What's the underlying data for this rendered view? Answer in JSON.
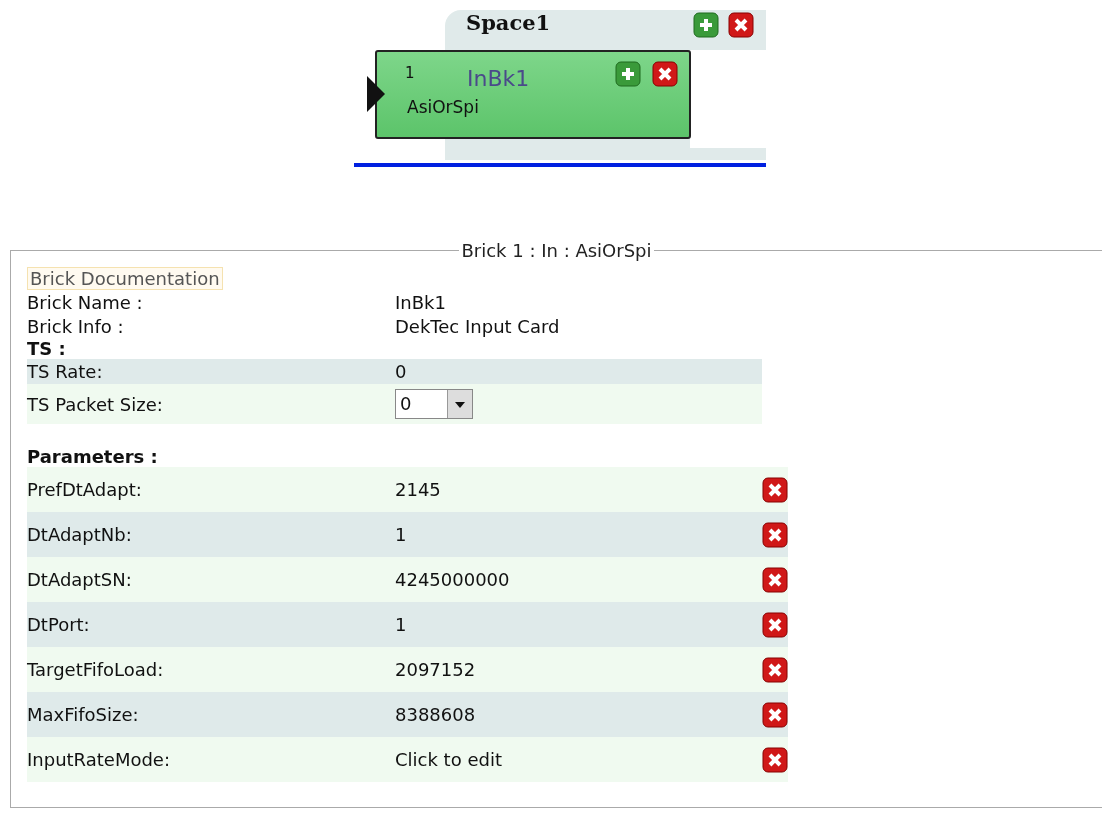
{
  "diagram": {
    "space": {
      "title": "Space1"
    },
    "brick": {
      "number": "1",
      "name": "InBk1",
      "type": "AsiOrSpi"
    }
  },
  "panel": {
    "legend": "Brick 1 : In : AsiOrSpi",
    "doc_link": "Brick Documentation",
    "info": [
      {
        "label": "Brick Name :",
        "value": "InBk1"
      },
      {
        "label": "Brick Info :",
        "value": "DekTec Input Card"
      }
    ],
    "ts_heading": "TS :",
    "ts_rows": [
      {
        "kind": "text",
        "label": "TS Rate:",
        "value": "0"
      },
      {
        "kind": "select",
        "label": "TS Packet Size:",
        "value": "0"
      }
    ],
    "params_heading": "Parameters :",
    "params": [
      {
        "label": "PrefDtAdapt:",
        "value": "2145"
      },
      {
        "label": "DtAdaptNb:",
        "value": "1"
      },
      {
        "label": "DtAdaptSN:",
        "value": "4245000000"
      },
      {
        "label": "DtPort:",
        "value": "1"
      },
      {
        "label": "TargetFifoLoad:",
        "value": "2097152"
      },
      {
        "label": "MaxFifoSize:",
        "value": "8388608"
      },
      {
        "label": "InputRateMode:",
        "value": "Click to edit"
      }
    ]
  }
}
